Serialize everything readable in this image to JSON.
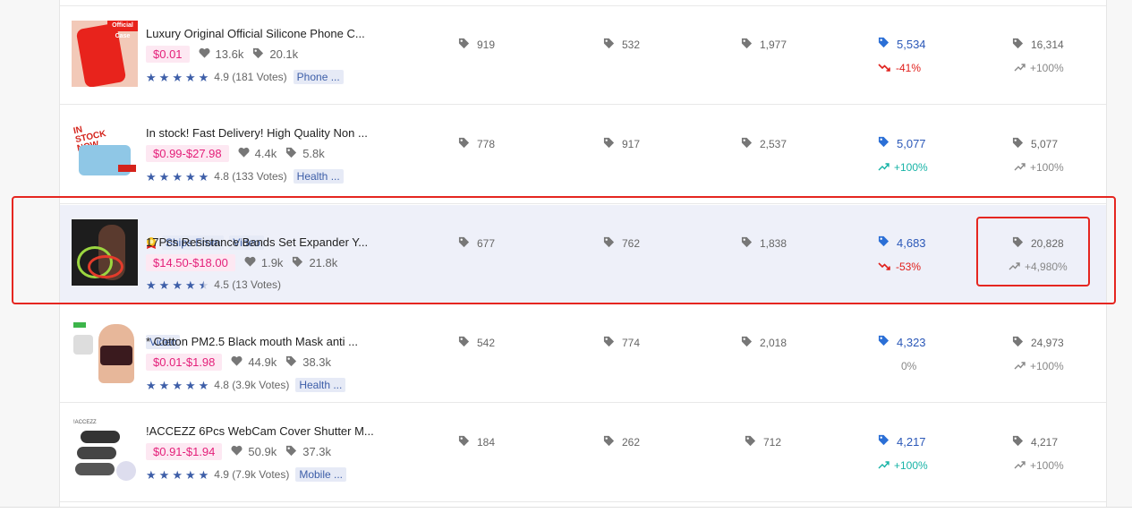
{
  "colors": {
    "price_pink": "#e4207a",
    "star_blue": "#3d5ea8",
    "down_red": "#e0201c",
    "up_teal": "#17b3a6",
    "highlight_border": "#e52620"
  },
  "icons": {
    "tag": "tag-icon",
    "heart": "heart-icon",
    "trend_up": "trend-up-icon",
    "trend_down": "trend-down-icon",
    "star": "star-icon",
    "medal": "medal-icon"
  },
  "products": [
    {
      "title": "Luxury Original Official Silicone Phone C...",
      "price": "$0.01",
      "likes": "13.6k",
      "orders": "20.1k",
      "stars": 5,
      "rating_text": "4.9 (181 Votes)",
      "category": "Phone ...",
      "badges": [],
      "thumb_label": "Official Case",
      "c1": "919",
      "c2": "532",
      "c3": "1,977",
      "c4": "5,534",
      "c4_change": "-41%",
      "c4_trend": "down",
      "c5": "16,314",
      "c5_change": "+100%"
    },
    {
      "title": "In stock! Fast Delivery! High Quality Non ...",
      "price": "$0.99-$27.98",
      "likes": "4.4k",
      "orders": "5.8k",
      "stars": 5,
      "rating_text": "4.8 (133 Votes)",
      "category": "Health ...",
      "badges": [],
      "thumb_label": "IN STOCK NOW",
      "c1": "778",
      "c2": "917",
      "c3": "2,537",
      "c4": "5,077",
      "c4_change": "+100%",
      "c4_trend": "up",
      "c5": "5,077",
      "c5_change": "+100%"
    },
    {
      "title": "17Pcs Resistance Bands Set Expander Y...",
      "price": "$14.50-$18.00",
      "likes": "1.9k",
      "orders": "21.8k",
      "stars": 4.5,
      "rating_text": "4.5 (13 Votes)",
      "category": "",
      "badges": [
        "Ships From",
        "Video"
      ],
      "thumb_label": "",
      "c1": "677",
      "c2": "762",
      "c3": "1,838",
      "c4": "4,683",
      "c4_change": "-53%",
      "c4_trend": "down",
      "c5": "20,828",
      "c5_change": "+4,980%"
    },
    {
      "title": "* Cotton PM2.5 Black mouth Mask anti ...",
      "price": "$0.01-$1.98",
      "likes": "44.9k",
      "orders": "38.3k",
      "stars": 5,
      "rating_text": "4.8 (3.9k Votes)",
      "category": "Health ...",
      "badges": [
        "Video"
      ],
      "thumb_label": "",
      "c1": "542",
      "c2": "774",
      "c3": "2,018",
      "c4": "4,323",
      "c4_change": "0%",
      "c4_trend": "flat",
      "c5": "24,973",
      "c5_change": "+100%"
    },
    {
      "title": "!ACCEZZ 6Pcs WebCam Cover Shutter M...",
      "price": "$0.91-$1.94",
      "likes": "50.9k",
      "orders": "37.3k",
      "stars": 5,
      "rating_text": "4.9 (7.9k Votes)",
      "category": "Mobile ...",
      "badges": [],
      "thumb_label": "!ACCEZZ",
      "c1": "184",
      "c2": "262",
      "c3": "712",
      "c4": "4,217",
      "c4_change": "+100%",
      "c4_trend": "up",
      "c5": "4,217",
      "c5_change": "+100%"
    }
  ]
}
